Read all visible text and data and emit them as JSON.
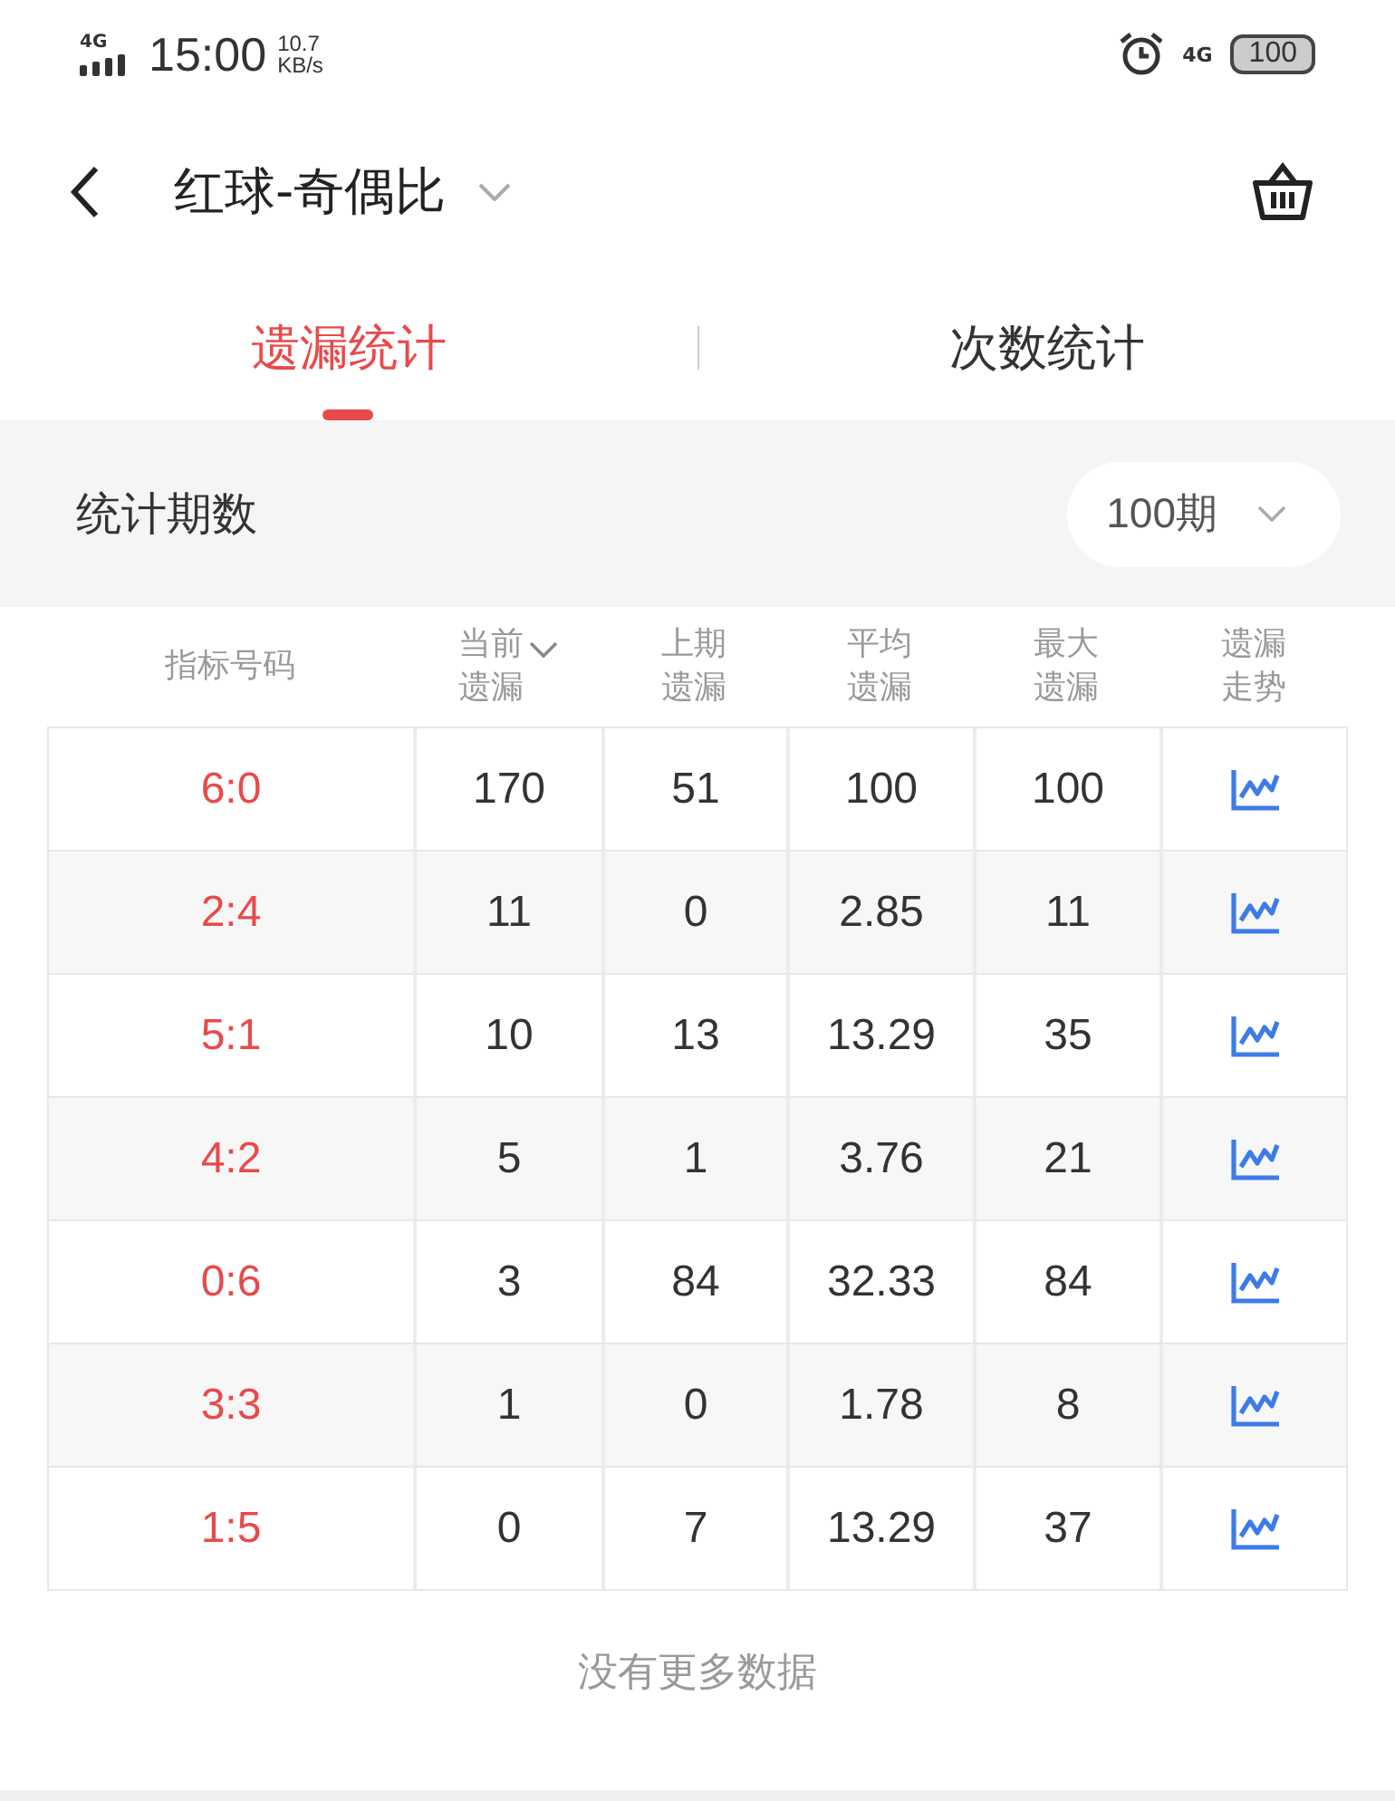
{
  "status_bar": {
    "network": "4G",
    "time": "15:00",
    "speed_value": "10.7",
    "speed_unit": "KB/s",
    "cell": "4G",
    "battery": "100"
  },
  "header": {
    "title": "红球-奇偶比"
  },
  "tabs": [
    {
      "label": "遗漏统计",
      "selected": true
    },
    {
      "label": "次数统计",
      "selected": false
    }
  ],
  "period": {
    "label": "统计期数",
    "value": "100期"
  },
  "table": {
    "columns": [
      {
        "label": "指标号码",
        "sorted": false
      },
      {
        "label": "当前遗漏",
        "sorted": true
      },
      {
        "label": "上期遗漏",
        "sorted": false
      },
      {
        "label": "平均遗漏",
        "sorted": false
      },
      {
        "label": "最大遗漏",
        "sorted": false
      },
      {
        "label": "遗漏走势",
        "sorted": false
      }
    ],
    "rows": [
      {
        "code": "6:0",
        "current": "170",
        "last": "51",
        "average": "100",
        "max": "100"
      },
      {
        "code": "2:4",
        "current": "11",
        "last": "0",
        "average": "2.85",
        "max": "11"
      },
      {
        "code": "5:1",
        "current": "10",
        "last": "13",
        "average": "13.29",
        "max": "35"
      },
      {
        "code": "4:2",
        "current": "5",
        "last": "1",
        "average": "3.76",
        "max": "21"
      },
      {
        "code": "0:6",
        "current": "3",
        "last": "84",
        "average": "32.33",
        "max": "84"
      },
      {
        "code": "3:3",
        "current": "1",
        "last": "0",
        "average": "1.78",
        "max": "8"
      },
      {
        "code": "1:5",
        "current": "0",
        "last": "7",
        "average": "13.29",
        "max": "37"
      }
    ]
  },
  "footer": "没有更多数据"
}
